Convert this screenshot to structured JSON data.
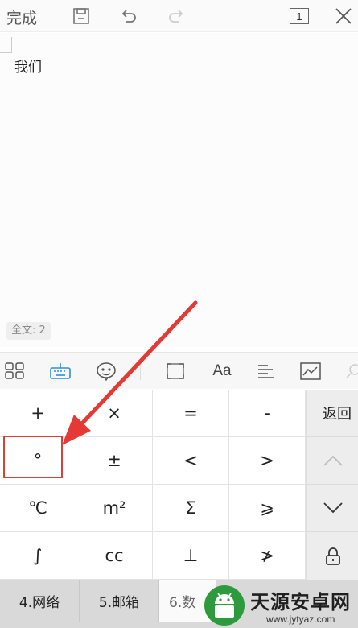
{
  "toolbar": {
    "done_label": "完成",
    "page_count": "1",
    "icons": [
      "save-icon",
      "undo-icon",
      "redo-icon",
      "page-icon",
      "close-icon"
    ]
  },
  "document": {
    "text": "我们",
    "word_count": "全文: 2"
  },
  "keyboard_toolbar": {
    "icons": [
      "grid-apps-icon",
      "keyboard-icon",
      "emoji-icon",
      "fullscreen-icon",
      "font-icon",
      "align-icon",
      "chart-icon",
      "voice-icon"
    ],
    "font_label": "Aa",
    "active_color": "#2b8fe0"
  },
  "symbols": {
    "rows": [
      [
        "+",
        "×",
        "=",
        "-"
      ],
      [
        "°",
        "±",
        "<",
        ">"
      ],
      [
        "℃",
        "m²",
        "Σ",
        "⩾"
      ],
      [
        "∫",
        "cc",
        "⊥",
        "≯"
      ]
    ]
  },
  "right_column": {
    "return_label": "返回",
    "icons": [
      "chevron-up-icon",
      "chevron-down-icon",
      "lock-icon"
    ]
  },
  "categories": [
    "4.网络",
    "5.邮箱",
    "6.数"
  ],
  "watermark": {
    "title": "天源安卓网",
    "url": "www.jytyaz.com",
    "brand_color": "#2e9a3e"
  },
  "annotation": {
    "color": "#d9403a"
  }
}
